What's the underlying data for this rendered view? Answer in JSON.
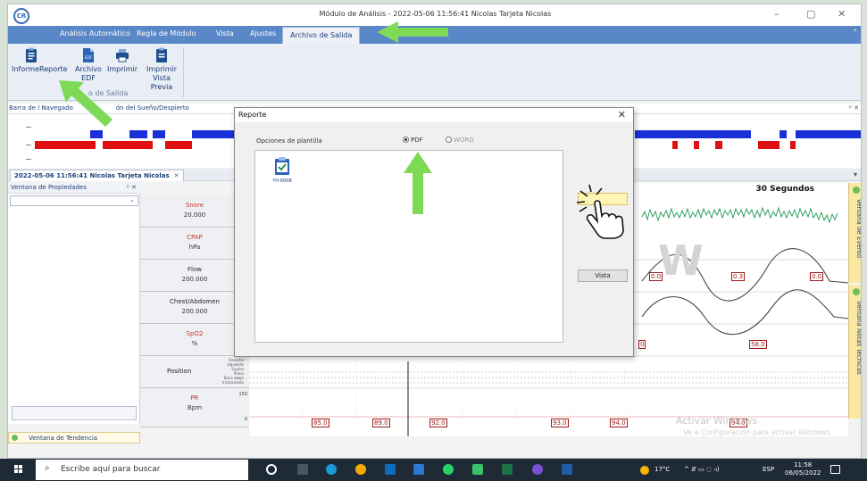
{
  "window": {
    "logo": "CR",
    "title": "Módulo de Análisis - 2022-05-06 11:56:41  Nicolas  Tarjeta  Nicolas",
    "minimize": "–",
    "maximize": "▢",
    "close": "✕"
  },
  "ribbon": {
    "tabs": [
      "Análisis Automático",
      "Regla de Módulo",
      "Vista",
      "Ajustes",
      "Archivo de Salida"
    ],
    "active_tab": "Archivo de Salida",
    "collapse_icon": "˄",
    "buttons": [
      {
        "label": "InformeReporte",
        "icon": "clipboard-icon"
      },
      {
        "label": "Archivo EDF",
        "icon": "edf-file-icon"
      },
      {
        "label": "Imprimir",
        "icon": "printer-icon"
      },
      {
        "label": "Imprimir Vista Previa",
        "icon": "print-preview-icon"
      }
    ],
    "button_labels": {
      "report": "InformeReporte",
      "edf_line1": "Archivo",
      "edf_line2": "EDF",
      "print": "Imprimir",
      "preview_line1": "Imprimir",
      "preview_line2": "Vista Previa"
    },
    "edf_icon_text": "EDF",
    "group_caption": "o de Salida"
  },
  "navigator": {
    "title": "Barra de l Navegado",
    "title_suffix": "ón del Sueño/Despierto",
    "pane_controls": "ᵖ ✕"
  },
  "document_tab": {
    "label": "2022-05-06 11:56:41  Nicolas  Tarjeta  Nicolas",
    "close": "✕",
    "scroll_icon": "▾"
  },
  "properties": {
    "title": "Ventana de Propiedades",
    "controls": "ᵖ ✕",
    "select_chevron": "⌄"
  },
  "trend_window": {
    "label": "Ventana de Tendencia"
  },
  "channels": [
    {
      "name": "Snore",
      "unit": "20.000"
    },
    {
      "name": "CPAP",
      "unit": "hPa"
    },
    {
      "name": "Flow",
      "unit": "200.000"
    },
    {
      "name": "Chest/Abdomen",
      "unit": "200.000"
    },
    {
      "name": "SpO2",
      "unit": "%"
    },
    {
      "name": "Position",
      "unit": ""
    },
    {
      "name": "PR",
      "unit": "Bpm"
    }
  ],
  "position_levels": [
    "Derecho",
    "Izquierdo",
    "Supino",
    "Prono",
    "Boca abajo",
    "Incorporado"
  ],
  "chart": {
    "segment_label": "30 Segundos",
    "pr_max_tick": "150",
    "pr_min_tick": "0",
    "flow_values": [
      "0.0",
      "0.3",
      "0.0"
    ],
    "spo2_values": [
      "0",
      "58.0"
    ],
    "pr_values": [
      "85.0",
      "89.0",
      "92.0",
      "93.0",
      "94.0",
      "94.0"
    ],
    "watermark_big": "W",
    "watermark_line1": "Activar Windows",
    "watermark_line2": "Ve a Configuración para activar Windows."
  },
  "side_panels": {
    "event": "Ventana de Evento",
    "notes": "Ventana Notas Técnicas"
  },
  "dialog": {
    "title": "Reporte",
    "close": "✕",
    "options_label": "Opciones de plantilla",
    "format_options": [
      "PDF",
      "WORD"
    ],
    "selected_format": "PDF",
    "templates": [
      {
        "name": "YH-600B",
        "icon": "clipboard-check-icon"
      }
    ],
    "buttons": {
      "primary": "",
      "view": "Vista"
    }
  },
  "taskbar": {
    "search_placeholder": "Escribe aquí para buscar",
    "search_icon": "⌕",
    "temperature": "17°C",
    "tray_symbols": "^  ⇵  ▭  ◌  ◃)",
    "language": "ESP",
    "time": "11:58",
    "date": "06/05/2022"
  },
  "colors": {
    "ribbon_blue": "#5a87c8",
    "sleep_blue": "#1a2fd6",
    "wake_red": "#e01010",
    "arrow_green": "#7ed957",
    "value_box_red": "#a01818",
    "side_panel_yellow": "#fbe8a3"
  }
}
